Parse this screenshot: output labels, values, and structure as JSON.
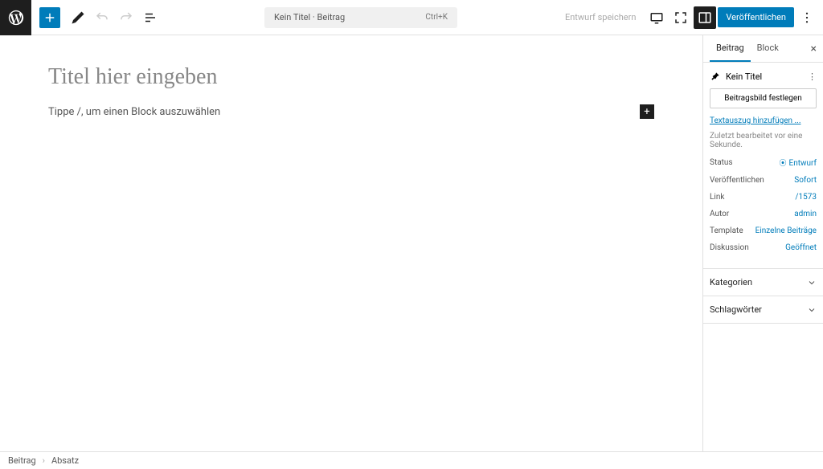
{
  "toolbar": {
    "doc_title": "Kein Titel · Beitrag",
    "shortcut": "Ctrl+K",
    "save_draft": "Entwurf speichern",
    "publish": "Veröffentlichen"
  },
  "editor": {
    "title_placeholder": "Titel hier eingeben",
    "block_placeholder": "Tippe /, um einen Block auszuwählen"
  },
  "sidebar": {
    "tabs": {
      "post": "Beitrag",
      "block": "Block"
    },
    "summary_title": "Kein Titel",
    "featured_image_btn": "Beitragsbild festlegen",
    "excerpt_link": "Textauszug hinzufügen ...",
    "last_edited": "Zuletzt bearbeitet vor eine Sekunde.",
    "rows": {
      "status": {
        "label": "Status",
        "value": "Entwurf"
      },
      "publish": {
        "label": "Veröffentlichen",
        "value": "Sofort"
      },
      "link": {
        "label": "Link",
        "value": "/1573"
      },
      "author": {
        "label": "Autor",
        "value": "admin"
      },
      "template": {
        "label": "Template",
        "value": "Einzelne Beiträge"
      },
      "discussion": {
        "label": "Diskussion",
        "value": "Geöffnet"
      }
    },
    "accordions": {
      "categories": "Kategorien",
      "tags": "Schlagwörter"
    }
  },
  "breadcrumb": {
    "root": "Beitrag",
    "current": "Absatz"
  }
}
